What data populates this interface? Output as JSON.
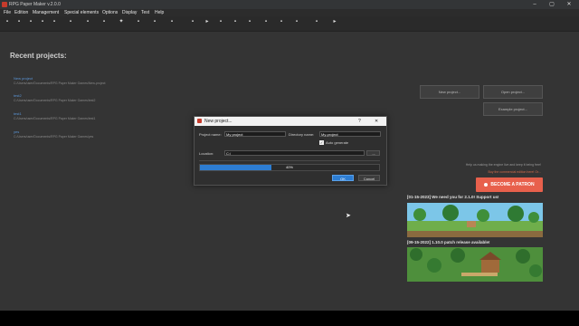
{
  "window": {
    "title": "RPG Paper Maker v.2.0.0",
    "minimize": "–",
    "maximize": "▢",
    "close": "✕"
  },
  "menu": [
    "File",
    "Edition",
    "Management",
    "Special elements",
    "Options",
    "Display",
    "Test",
    "Help"
  ],
  "recent": {
    "title": "Recent projects:",
    "items": [
      {
        "name": "New project",
        "path": "C:/Users/user/Documents/RPG Paper Maker Games/New-project"
      },
      {
        "name": "test2",
        "path": "C:/Users/user/Documents/RPG Paper Maker Games/test2"
      },
      {
        "name": "test1",
        "path": "C:/Users/user/Documents/RPG Paper Maker Games/test1"
      },
      {
        "name": "yes",
        "path": "C:/Users/user/Documents/RPG Paper Maker Games/yes"
      }
    ]
  },
  "side_buttons": {
    "new_project": "New project...",
    "open_project": "Open project...",
    "example_project": "Example project..."
  },
  "support": {
    "help": "Help us making the engine live and keep it being free!",
    "buy": "Buy the commercial edition here! Or...",
    "patron": "BECOME A PATRON"
  },
  "news": [
    {
      "title": "[01-15-2023] We need you for 2.1.0! Support us!"
    },
    {
      "title": "[09-15-2022] 1.10.0 patch release available!"
    }
  ],
  "dialog": {
    "title": "New project...",
    "help": "?",
    "close": "✕",
    "project_name_label": "Project name:",
    "project_name_value": "My project",
    "directory_name_label": "Directory name:",
    "directory_name_value": "My-project",
    "auto_generate_label": "Auto generate",
    "auto_generate_checked": "✓",
    "location_label": "Location:",
    "location_value": "C:/",
    "browse": "...",
    "progress_percent": 40,
    "progress_text": "40%",
    "ok": "OK",
    "cancel": "Cancel"
  },
  "colors": {
    "accent": "#2d7dd2",
    "patron": "#e8604c",
    "link": "#5b95d6"
  }
}
